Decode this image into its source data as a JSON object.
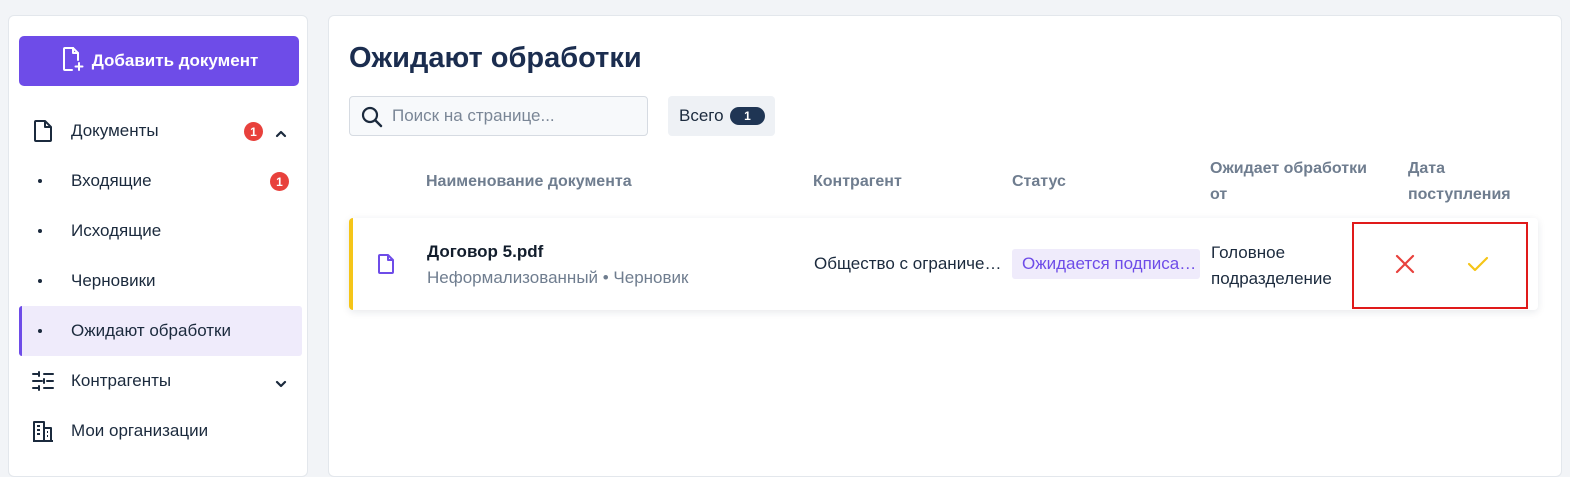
{
  "sidebar": {
    "add_button_label": "Добавить документ",
    "items": [
      {
        "label": "Документы",
        "badge": "1",
        "icon": "file-icon",
        "chevron": "up"
      },
      {
        "label": "Входящие",
        "badge": "1"
      },
      {
        "label": "Исходящие"
      },
      {
        "label": "Черновики"
      },
      {
        "label": "Ожидают обработки",
        "active": true
      },
      {
        "label": "Контрагенты",
        "icon": "counterparties-icon",
        "chevron": "down"
      },
      {
        "label": "Мои организации",
        "icon": "building-icon"
      }
    ]
  },
  "main": {
    "title": "Ожидают обработки",
    "search": {
      "placeholder": "Поиск на странице..."
    },
    "total": {
      "label": "Всего",
      "count": "1"
    },
    "columns": {
      "name": "Наименование документа",
      "counterparty": "Контрагент",
      "status": "Статус",
      "pending_line1": "Ожидает обработки",
      "pending_line2": "от",
      "date_line1": "Дата",
      "date_line2": "поступления"
    },
    "rows": [
      {
        "name": "Договор 5.pdf",
        "meta": "Неформализованный • Черновик",
        "counterparty": "Общество с ограниченной ответственностью",
        "status": "Ожидается подписание",
        "pending_line1": "Головное",
        "pending_line2": "подразделение"
      }
    ]
  },
  "colors": {
    "accent": "#6e4ce8",
    "badge": "#e8413c",
    "row_marker": "#f5c518",
    "reject": "#e8413c",
    "approve": "#f5c518",
    "highlight": "#e01a1a"
  }
}
